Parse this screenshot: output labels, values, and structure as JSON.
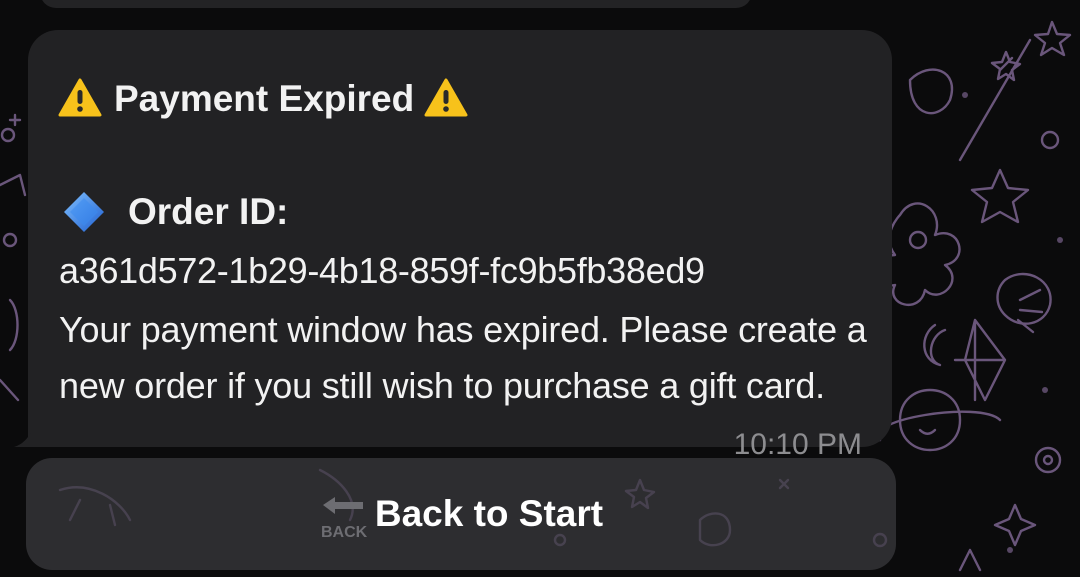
{
  "message": {
    "title": "Payment Expired",
    "title_icon": "warning-icon",
    "order_label": "Order ID:",
    "order_icon": "blue-diamond-icon",
    "order_id": "a361d572-1b29-4b18-859f-fc9b5fb38ed9",
    "body": "Your payment window has expired. Please create a new order if you still wish to purchase a gift card.",
    "time": "10:10 PM"
  },
  "keyboard": {
    "button_label": "Back to Start",
    "button_icon": "back-arrow-icon",
    "icon_text": "BACK"
  },
  "colors": {
    "background": "#0b0b0c",
    "bubble": "#222224",
    "button": "#3a3a3e",
    "doodle": "#8a6fa0",
    "warning": "#f7c21b",
    "diamond": "#2f7fe6"
  }
}
